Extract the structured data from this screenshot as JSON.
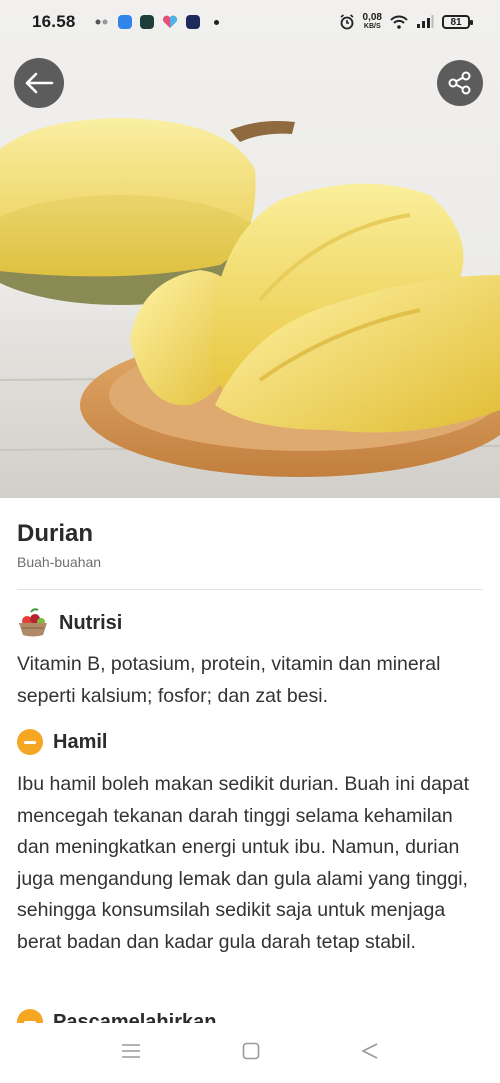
{
  "status_bar": {
    "time": "16.58",
    "net_speed_value": "0,08",
    "net_speed_unit": "KB/S",
    "battery": "81",
    "icons": [
      "notification-icon",
      "app-icon",
      "app-icon",
      "app-icon",
      "app-icon",
      "alarm-icon",
      "wifi-icon",
      "signal-icon",
      "battery-icon"
    ]
  },
  "header": {
    "back_icon": "arrow-left-icon",
    "share_icon": "share-icon"
  },
  "food": {
    "title": "Durian",
    "category": "Buah-buahan"
  },
  "sections": [
    {
      "label": "Nutrisi",
      "icon": "fruit-basket-icon",
      "text": "Vitamin B, potasium, protein, vitamin dan mineral seperti kalsium; fosfor; dan zat besi."
    },
    {
      "label": "Hamil",
      "icon": "minus-circle-icon",
      "color": "#f5a623",
      "text": "Ibu hamil boleh makan sedikit durian. Buah ini dapat mencegah tekanan darah tinggi selama kehamilan dan meningkatkan energi untuk ibu. Namun, durian juga mengandung lemak dan gula alami yang tinggi, sehingga konsumsilah sedikit saja untuk menjaga berat badan dan kadar gula darah tetap stabil."
    },
    {
      "label": "Pascamelahirkan",
      "icon": "minus-circle-icon",
      "color": "#f5a623"
    }
  ],
  "nav_bar": {
    "icons": [
      "menu-icon",
      "home-icon",
      "back-triangle-icon"
    ]
  }
}
